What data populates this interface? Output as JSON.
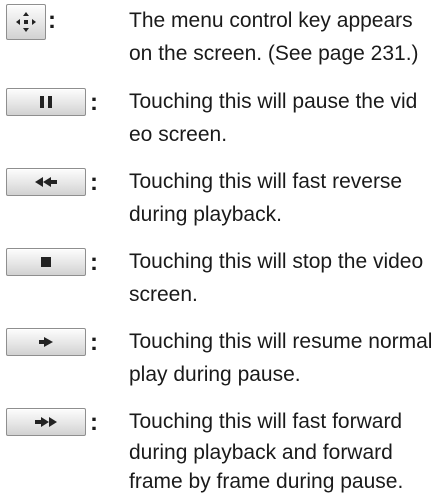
{
  "controls": [
    {
      "icon": "menu-control-key-icon",
      "lines": [
        "The menu control key appears",
        "on the screen.  (See page 231.)"
      ]
    },
    {
      "icon": "pause-icon",
      "lines": [
        "Touching this will pause the vid",
        "eo screen."
      ]
    },
    {
      "icon": "fast-reverse-icon",
      "lines": [
        "Touching this will fast reverse",
        "during playback."
      ]
    },
    {
      "icon": "stop-icon",
      "lines": [
        "Touching this will stop the video",
        "screen."
      ]
    },
    {
      "icon": "play-icon",
      "lines": [
        "Touching this will resume normal",
        "play during pause."
      ]
    },
    {
      "icon": "fast-forward-icon",
      "lines": [
        "Touching this will fast forward",
        "during playback and forward",
        "frame by frame during pause."
      ]
    }
  ],
  "separator": ":"
}
